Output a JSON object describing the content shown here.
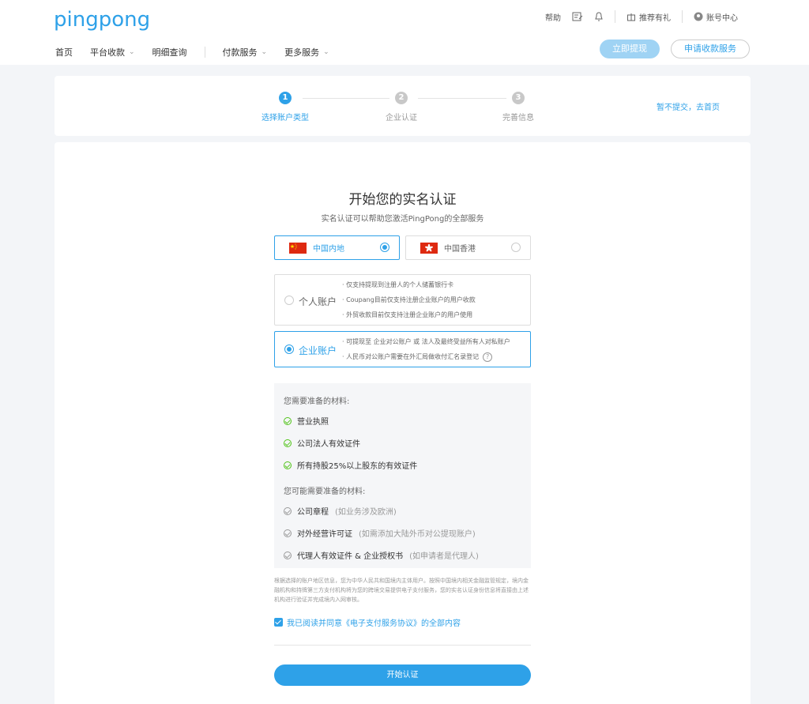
{
  "header": {
    "logo": "pingpong",
    "help": "帮助",
    "recommend": "推荐有礼",
    "account": "账号中心",
    "nav": [
      {
        "label": "首页",
        "has_chevron": false
      },
      {
        "label": "平台收款",
        "has_chevron": true
      },
      {
        "label": "明细查询",
        "has_chevron": false
      },
      {
        "label": "付款服务",
        "has_chevron": true
      },
      {
        "label": "更多服务",
        "has_chevron": true
      }
    ],
    "withdraw_button": "立即提现",
    "apply_button": "申请收款服务"
  },
  "steps": [
    {
      "num": "1",
      "label": "选择账户类型",
      "state": "active"
    },
    {
      "num": "2",
      "label": "企业认证",
      "state": "inactive"
    },
    {
      "num": "3",
      "label": "完善信息",
      "state": "inactive"
    }
  ],
  "skip_link": "暂不提交，去首页",
  "main": {
    "title": "开始您的实名认证",
    "subtitle": "实名认证可以帮助您激活PingPong的全部服务",
    "regions": [
      {
        "label": "中国内地",
        "selected": true
      },
      {
        "label": "中国香港",
        "selected": false
      }
    ],
    "accounts": [
      {
        "name": "个人账户",
        "selected": false,
        "lines": [
          "· 仅支持提现到注册人的个人储蓄银行卡",
          "· Coupang目前仅支持注册企业账户的用户收款",
          "· 外贸收款目前仅支持注册企业账户的用户使用"
        ]
      },
      {
        "name": "企业账户",
        "selected": true,
        "lines": [
          "· 可提现至 企业对公账户 或 法人及最终受益所有人对私账户",
          "· 人民币对公账户需要在外汇局做收付汇名录登记"
        ]
      }
    ],
    "required_heading": "您需要准备的材料:",
    "required_items": [
      "营业执照",
      "公司法人有效证件",
      "所有持股25%以上股东的有效证件"
    ],
    "optional_heading": "您可能需要准备的材料:",
    "optional_items": [
      {
        "label": "公司章程",
        "note": "(如业务涉及欧洲)"
      },
      {
        "label": "对外经营许可证",
        "note": "(如需添加大陆外币对公提现账户)"
      },
      {
        "label": "代理人有效证件 & 企业授权书",
        "note": "(如申请者是代理人)"
      }
    ],
    "disclaimer": "根据选择的账户地区信息，您为中华人民共和国境内主体用户。按照中国境内相关金融监管规定，境内金融机构和持牌第三方支付机构将为您的跨境交易提供电子支付服务，您的实名认证身份信息将直接由上述机构进行验证并完成境内入网审核。",
    "agree_prefix": "我已阅读并同意",
    "agree_link": "《电子支付服务协议》",
    "agree_suffix": "的全部内容",
    "start_button": "开始认证"
  },
  "colors": {
    "accent": "#2ea1e8",
    "check": "#52c41a"
  }
}
